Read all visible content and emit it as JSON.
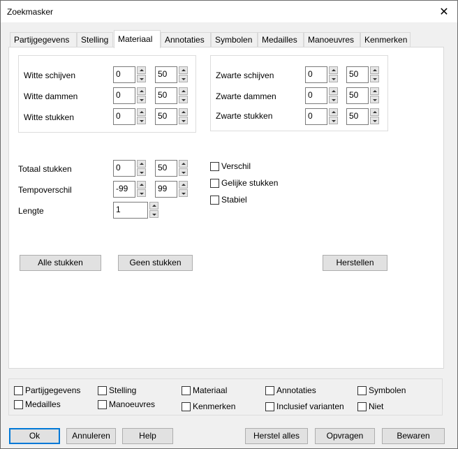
{
  "window": {
    "title": "Zoekmasker"
  },
  "tabs": [
    {
      "label": "Partijgegevens"
    },
    {
      "label": "Stelling"
    },
    {
      "label": "Materiaal"
    },
    {
      "label": "Annotaties"
    },
    {
      "label": "Symbolen"
    },
    {
      "label": "Medailles"
    },
    {
      "label": "Manoeuvres"
    },
    {
      "label": "Kenmerken"
    }
  ],
  "active_tab": "Materiaal",
  "white_group": [
    {
      "label": "Witte schijven",
      "min": "0",
      "max": "50"
    },
    {
      "label": "Witte dammen",
      "min": "0",
      "max": "50"
    },
    {
      "label": "Witte stukken",
      "min": "0",
      "max": "50"
    }
  ],
  "black_group": [
    {
      "label": "Zwarte schijven",
      "min": "0",
      "max": "50"
    },
    {
      "label": "Zwarte dammen",
      "min": "0",
      "max": "50"
    },
    {
      "label": "Zwarte stukken",
      "min": "0",
      "max": "50"
    }
  ],
  "totals": {
    "total_label": "Totaal stukken",
    "total_min": "0",
    "total_max": "50",
    "tempo_label": "Tempoverschil",
    "tempo_min": "-99",
    "tempo_max": "99",
    "length_label": "Lengte",
    "length_value": "1"
  },
  "options": [
    {
      "label": "Verschil",
      "checked": false
    },
    {
      "label": "Gelijke stukken",
      "checked": false
    },
    {
      "label": "Stabiel",
      "checked": false
    }
  ],
  "panel_buttons": {
    "all": "Alle stukken",
    "none": "Geen stukken",
    "reset": "Herstellen"
  },
  "filters": [
    {
      "label": "Partijgegevens",
      "checked": false
    },
    {
      "label": "Stelling",
      "checked": false
    },
    {
      "label": "Materiaal",
      "checked": false
    },
    {
      "label": "Annotaties",
      "checked": false
    },
    {
      "label": "Symbolen",
      "checked": false
    },
    {
      "label": "Medailles",
      "checked": false
    },
    {
      "label": "Manoeuvres",
      "checked": false
    },
    {
      "label": "Kenmerken",
      "checked": false
    },
    {
      "label": "Inclusief varianten",
      "checked": false
    },
    {
      "label": "Niet",
      "checked": false
    }
  ],
  "dialog_buttons": {
    "ok": "Ok",
    "cancel": "Annuleren",
    "help": "Help",
    "reset_all": "Herstel alles",
    "query": "Opvragen",
    "save": "Bewaren"
  },
  "colors": {
    "focus_border": "#0078d7",
    "panel_bg": "#ffffff",
    "window_bg": "#f0f0f0"
  }
}
